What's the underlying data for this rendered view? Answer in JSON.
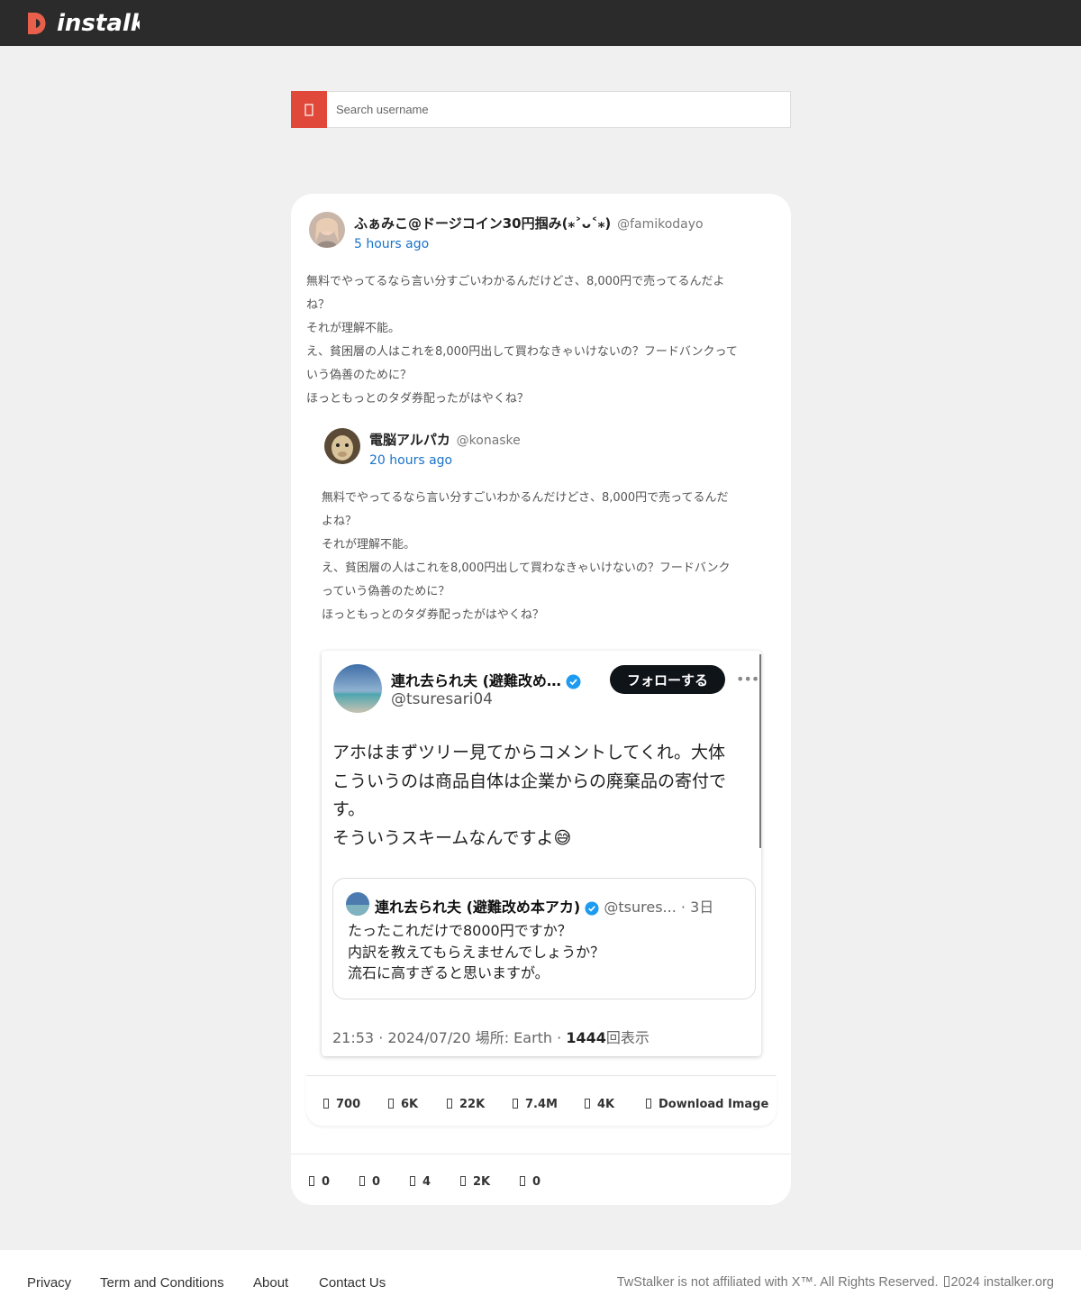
{
  "header": {
    "logo_text": "instalk",
    "logo_color": "#e8604c",
    "bar_color": "#2b2b2b"
  },
  "search": {
    "placeholder": "Search username",
    "button_color": "#e0483a",
    "icon": "search-icon"
  },
  "post": {
    "name": "ふぁみこ@ドージコイン30円掴み(⁎˃ᴗ˂⁎)",
    "handle": "@famikodayo",
    "time": "5 hours ago",
    "lines": [
      "無料でやってるなら言い分すごいわかるんだけどさ、8,000円で売ってるんだよ",
      "ね？",
      "それが理解不能。",
      "え、貧困層の人はこれを8,000円出して買わなきゃいけないの？フードバンクって",
      "いう偽善のために？",
      "ほっともっとのタダ券配ったがはやくね？"
    ],
    "stats": [
      "0",
      "0",
      "4",
      "2K",
      "0"
    ]
  },
  "quoted_post": {
    "name": "電脳アルパカ",
    "handle": "@konaske",
    "time": "20 hours ago",
    "lines": [
      "無料でやってるなら言い分すごいわかるんだけどさ、8,000円で売ってるんだ",
      "よね？",
      "それが理解不能。",
      "え、貧困層の人はこれを8,000円出して買わなきゃいけないの？フードバンク",
      "っていう偽善のために？",
      "ほっともっとのタダ券配ったがはやくね？"
    ],
    "stats": [
      "700",
      "6K",
      "22K",
      "7.4M",
      "4K"
    ],
    "download_label": "Download Image"
  },
  "embed": {
    "name": "連れ去られ夫 (避難改め…",
    "handle": "@tsuresari04",
    "follow_label": "フォローする",
    "more_label": "•••",
    "text_lines": [
      "アホはまずツリー見てからコメントしてくれ。大体",
      "こういうのは商品自体は企業からの廃棄品の寄付で",
      "す。",
      "そういうスキームなんですよ😅"
    ],
    "quote": {
      "name": "連れ去られ夫 (避難改め本アカ)",
      "meta": "@tsures... · 3日",
      "lines": [
        "たったこれだけで8000円ですか？",
        "内訳を教えてもらえませんでしょうか？",
        "流石に高すぎると思いますが。"
      ]
    },
    "footer_time": "21:53 · 2024/07/20",
    "footer_place": "場所: Earth ·",
    "footer_views": "1444",
    "footer_views_label": "回表示",
    "verified_color": "#1d9bf0"
  },
  "footer": {
    "links": [
      "Privacy",
      "Term and Conditions",
      "About",
      "Contact Us"
    ],
    "copyright_pre": "TwStalker is not affiliated with X™. All Rights Reserved.",
    "copyright_post": "2024 instalker.org"
  }
}
